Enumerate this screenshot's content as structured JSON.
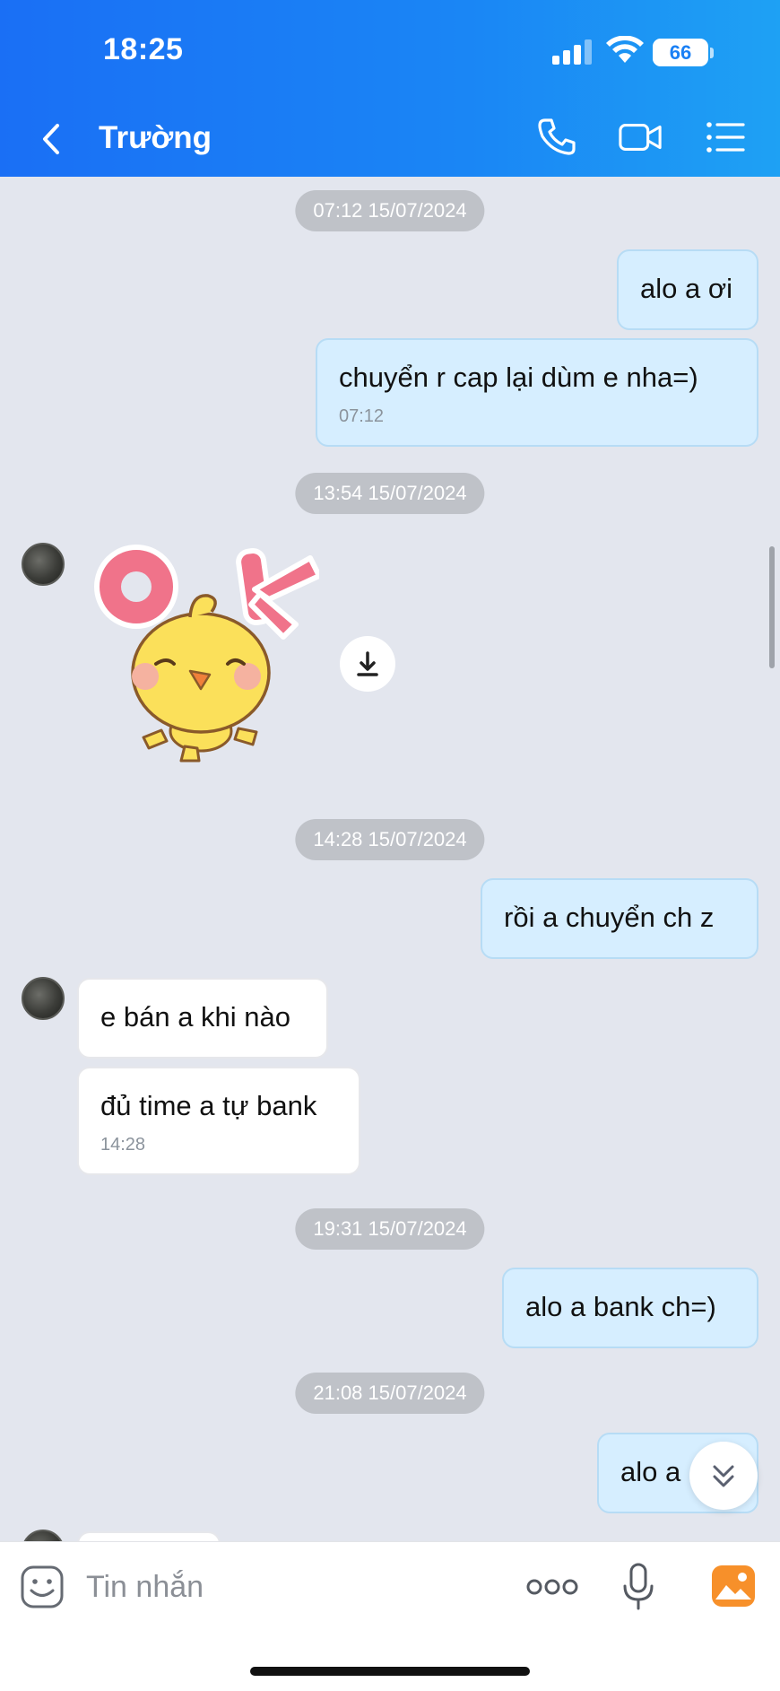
{
  "status_bar": {
    "time": "18:25",
    "battery": "66",
    "battery_level": 0.66
  },
  "header": {
    "contact_name": "Trường"
  },
  "messages": {
    "t1": "07:12 15/07/2024",
    "m1": "alo a ơi",
    "m2": "chuyển r cap lại dùm e nha=)",
    "m2_time": "07:12",
    "t2": "13:54 15/07/2024",
    "t3": "14:28 15/07/2024",
    "m3": "rồi a chuyển ch z",
    "m4": "e bán a khi nào",
    "m5": "đủ time a tự bank",
    "m5_time": "14:28",
    "t4": "19:31 15/07/2024",
    "m6": "alo a bank ch=)",
    "t5": "21:08 15/07/2024",
    "m7": "alo a"
  },
  "sticker": {
    "name": "ok-chick-sticker",
    "text": "OK"
  },
  "input": {
    "placeholder": "Tin nhắn"
  },
  "colors": {
    "header_start": "#1a6ff5",
    "header_end": "#1ea1f4",
    "outgoing": "#d6eeff",
    "incoming": "#ffffff",
    "background": "#e3e6ee"
  }
}
